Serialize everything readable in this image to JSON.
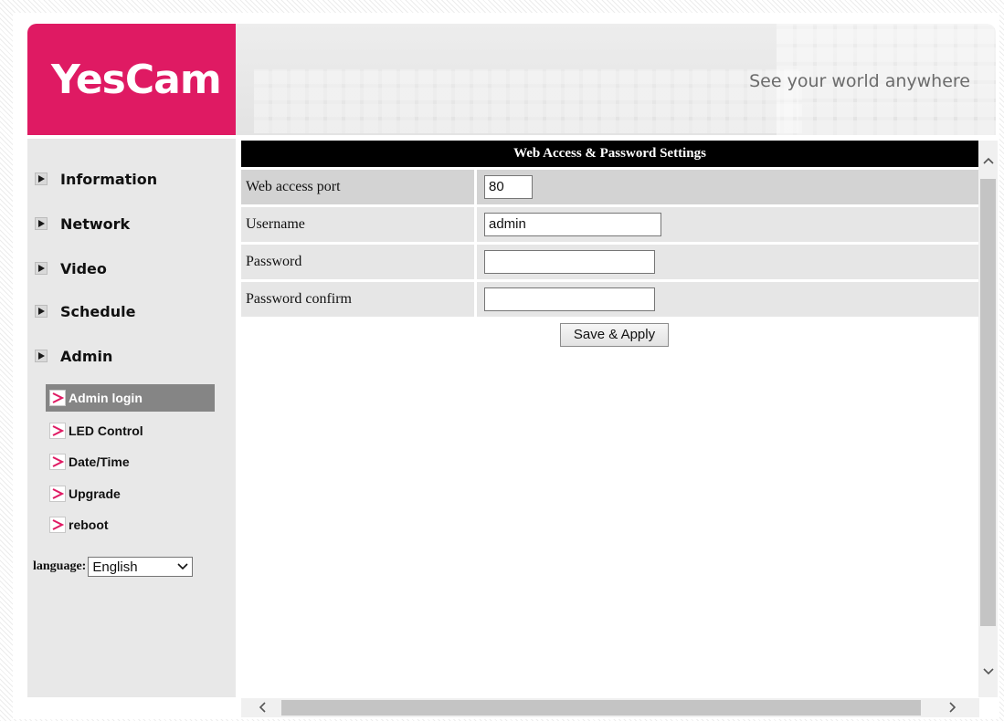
{
  "header": {
    "logo_text": "YesCam",
    "tagline": "See your world anywhere"
  },
  "sidebar": {
    "items": [
      {
        "label": "Information"
      },
      {
        "label": "Network"
      },
      {
        "label": "Video"
      },
      {
        "label": "Schedule"
      },
      {
        "label": "Admin"
      }
    ],
    "sub_items": [
      {
        "label": "Admin login",
        "active": true
      },
      {
        "label": "LED Control"
      },
      {
        "label": "Date/Time"
      },
      {
        "label": "Upgrade"
      },
      {
        "label": "reboot"
      }
    ],
    "language": {
      "label": "language:",
      "selected": "English"
    }
  },
  "form": {
    "title": "Web Access & Password Settings",
    "rows": [
      {
        "label": "Web access port",
        "value": "80"
      },
      {
        "label": "Username",
        "value": "admin"
      },
      {
        "label": "Password",
        "value": ""
      },
      {
        "label": "Password confirm",
        "value": ""
      }
    ],
    "save_label": "Save & Apply"
  },
  "colors": {
    "brand": "#df1a63",
    "active_sub": "#858585"
  }
}
